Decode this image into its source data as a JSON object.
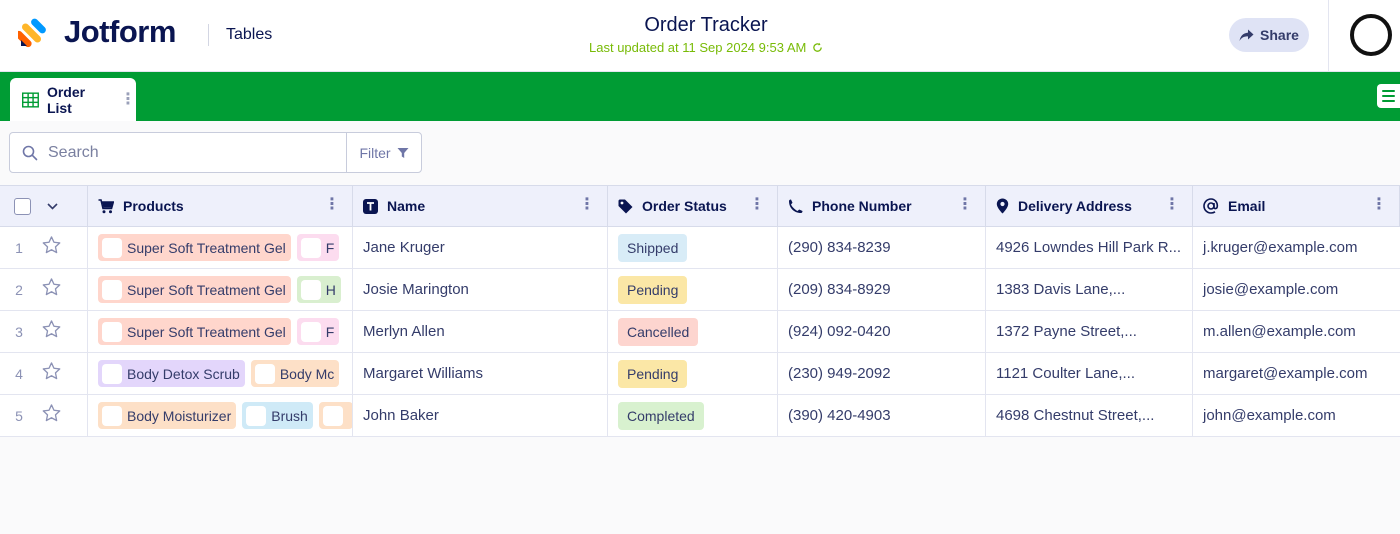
{
  "header": {
    "brand": "Jotform",
    "product": "Tables",
    "title": "Order Tracker",
    "last_updated": "Last updated at 11 Sep 2024 9:53 AM",
    "share_label": "Share"
  },
  "tabs": [
    {
      "label": "Order List"
    }
  ],
  "toolbar": {
    "search_placeholder": "Search",
    "filter_label": "Filter"
  },
  "table": {
    "columns": [
      {
        "label": "Products",
        "icon": "cart-icon"
      },
      {
        "label": "Name",
        "icon": "text-icon"
      },
      {
        "label": "Order Status",
        "icon": "tag-icon"
      },
      {
        "label": "Phone Number",
        "icon": "phone-icon"
      },
      {
        "label": "Delivery Address",
        "icon": "location-pin-icon"
      },
      {
        "label": "Email",
        "icon": "at-icon"
      }
    ],
    "rows": [
      {
        "num": "1",
        "products": [
          {
            "label": "Super Soft Treatment Gel",
            "color": "#ffd6cc"
          },
          {
            "label": "F",
            "color": "#fcdcef"
          }
        ],
        "name": "Jane Kruger",
        "status": "Shipped",
        "status_color": "#d8ecf7",
        "phone": "(290) 834-8239",
        "address": "4926 Lowndes Hill Park R...",
        "email": "j.kruger@example.com"
      },
      {
        "num": "2",
        "products": [
          {
            "label": "Super Soft Treatment Gel",
            "color": "#ffd6cc"
          },
          {
            "label": "H",
            "color": "#d9efcf"
          }
        ],
        "name": "Josie Marington",
        "status": "Pending",
        "status_color": "#fbe7a6",
        "phone": "(209) 834-8929",
        "address": "1383 Davis Lane,...",
        "email": "josie@example.com"
      },
      {
        "num": "3",
        "products": [
          {
            "label": "Super Soft Treatment Gel",
            "color": "#ffd6cc"
          },
          {
            "label": "F",
            "color": "#fcdcef"
          }
        ],
        "name": "Merlyn Allen",
        "status": "Cancelled",
        "status_color": "#fdd5cf",
        "phone": "(924) 092-0420",
        "address": "1372 Payne Street,...",
        "email": "m.allen@example.com"
      },
      {
        "num": "4",
        "products": [
          {
            "label": "Body Detox Scrub",
            "color": "#e3d6fb"
          },
          {
            "label": "Body Mc",
            "color": "#fde0c7"
          }
        ],
        "name": "Margaret Williams",
        "status": "Pending",
        "status_color": "#fbe7a6",
        "phone": "(230) 949-2092",
        "address": "1121 Coulter Lane,...",
        "email": "margaret@example.com"
      },
      {
        "num": "5",
        "products": [
          {
            "label": "Body Moisturizer",
            "color": "#fde0c7"
          },
          {
            "label": "Brush",
            "color": "#cfeaf7"
          },
          {
            "label": "",
            "color": "#fde0c7"
          }
        ],
        "name": "John Baker",
        "status": "Completed",
        "status_color": "#d8f1cf",
        "phone": "(390) 420-4903",
        "address": "4698 Chestnut Street,...",
        "email": "john@example.com"
      }
    ]
  },
  "colors": {
    "tab_bar": "#009c34",
    "updated_text": "#78bb07",
    "header_bg": "#eef0fb"
  }
}
